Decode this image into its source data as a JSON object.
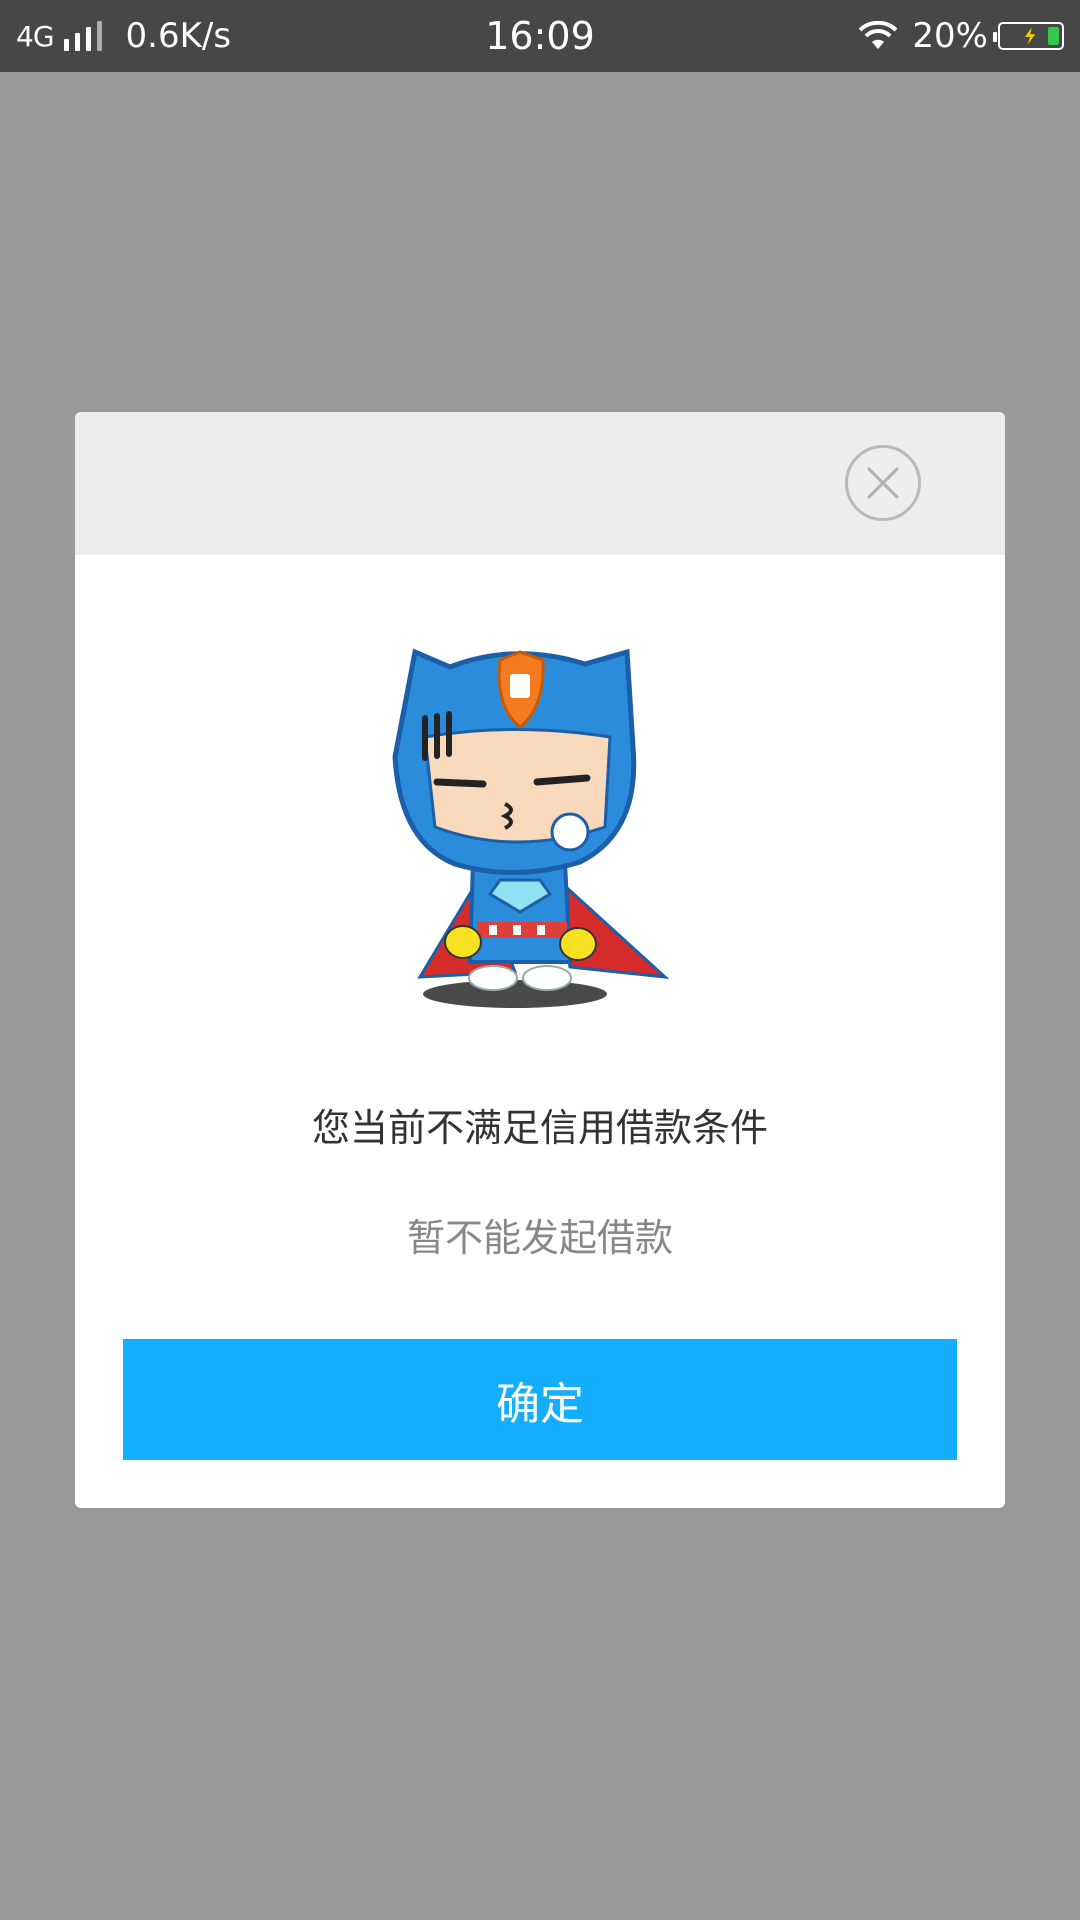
{
  "status_bar": {
    "network": "4G",
    "speed": "0.6K/s",
    "time": "16:09",
    "battery_percent": "20%",
    "battery_level": 0.2,
    "icons": [
      "signal-icon",
      "wifi-icon",
      "battery-charging-icon"
    ]
  },
  "dialog": {
    "close_icon": "close-circle-icon",
    "illustration": "superhero-mascot",
    "title": "您当前不满足信用借款条件",
    "subtitle": "暂不能发起借款",
    "confirm_label": "确定"
  },
  "colors": {
    "overlay": "#999999",
    "status_bar": "#474747",
    "dialog_header": "#ededed",
    "primary_button": "#14aeff",
    "title_text": "#333333",
    "subtitle_text": "#888888"
  }
}
